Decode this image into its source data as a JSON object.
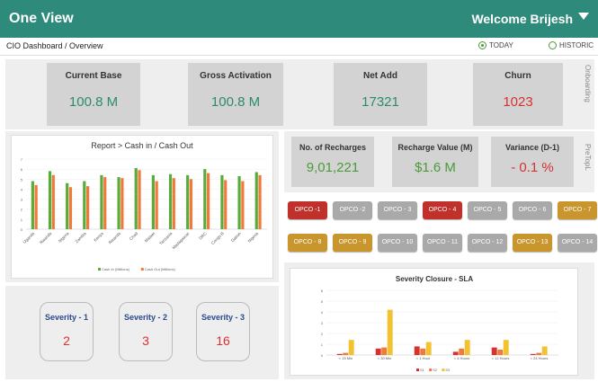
{
  "header": {
    "app_title": "One View",
    "welcome": "Welcome Brijesh"
  },
  "crumbs": {
    "path": "CIO Dashboard / Overview",
    "today": "TODAY",
    "historic": "HISTORIC",
    "selected": "TODAY"
  },
  "kpis": [
    {
      "label": "Current Base",
      "value": "100.8 M",
      "color": "#2e8a6e"
    },
    {
      "label": "Gross Activation",
      "value": "100.8 M",
      "color": "#2e8a6e"
    },
    {
      "label": "Net Add",
      "value": "17321",
      "color": "#2e8a6e"
    },
    {
      "label": "Churn",
      "value": "1023",
      "color": "#d93030"
    }
  ],
  "onboarding_label": "Onboarding",
  "recharge": {
    "side_label": "PreTopL",
    "cards": [
      {
        "label": "No. of Recharges",
        "value": "9,01,221",
        "color": "#4a9b3a"
      },
      {
        "label": "Recharge Value (M)",
        "value": "$1.6 M",
        "color": "#4a9b3a"
      },
      {
        "label": "Variance (D-1)",
        "value": "- 0.1 %",
        "color": "#d93030"
      }
    ]
  },
  "opco_buttons": [
    {
      "label": "OPCO -1",
      "status": "red"
    },
    {
      "label": "OPCO -2",
      "status": "grey"
    },
    {
      "label": "OPCO - 3",
      "status": "grey"
    },
    {
      "label": "OPCO - 4",
      "status": "red"
    },
    {
      "label": "OPCO - 5",
      "status": "grey"
    },
    {
      "label": "OPCO - 6",
      "status": "grey"
    },
    {
      "label": "OPCO - 7",
      "status": "amber"
    },
    {
      "label": "OPCO - 8",
      "status": "amber"
    },
    {
      "label": "OPCO - 9",
      "status": "amber"
    },
    {
      "label": "OPCO - 10",
      "status": "grey"
    },
    {
      "label": "OPCO - 11",
      "status": "grey"
    },
    {
      "label": "OPCO - 12",
      "status": "grey"
    },
    {
      "label": "OPCO - 13",
      "status": "amber"
    },
    {
      "label": "OPCO - 14",
      "status": "grey"
    }
  ],
  "status_colors": {
    "red": "#c0312b",
    "grey": "#a9a9a9",
    "amber": "#c9962e"
  },
  "severity": [
    {
      "label": "Severity - 1",
      "value": "2"
    },
    {
      "label": "Severity - 2",
      "value": "3"
    },
    {
      "label": "Severity - 3",
      "value": "16"
    }
  ],
  "chart_data": [
    {
      "type": "bar",
      "title": "Report >     Cash in / Cash Out",
      "categories": [
        "Uganda",
        "Rwanda",
        "Nigeria",
        "Zambia",
        "Kenya",
        "Rwanda",
        "Chad",
        "Malawi",
        "Tanzania",
        "Madagascar",
        "DRC",
        "Congo B",
        "Gabon",
        "Nigeria"
      ],
      "series": [
        {
          "name": "Cash In (Millions)",
          "color": "#5aab3c",
          "values": [
            4.8,
            5.8,
            4.6,
            4.8,
            5.4,
            5.2,
            6.1,
            5.4,
            5.5,
            5.4,
            6.0,
            5.4,
            5.3,
            5.7
          ]
        },
        {
          "name": "Cash Out (Millions)",
          "color": "#f07a3a",
          "values": [
            4.4,
            5.4,
            4.2,
            4.3,
            5.2,
            5.1,
            5.9,
            4.8,
            5.1,
            5.0,
            5.6,
            4.9,
            4.8,
            5.4
          ]
        }
      ],
      "yticks": [
        "0",
        "1",
        "2",
        "3",
        "4",
        "5",
        "6",
        "7"
      ],
      "ylim": [
        0,
        7
      ]
    },
    {
      "type": "bar",
      "title": "Severity Closure - SLA",
      "categories": [
        "< 15 Min",
        "< 30 Min",
        "< 1 Hour",
        "< 4 Hours",
        "< 12 Hours",
        "< 24 Hours"
      ],
      "series": [
        {
          "name": "S1",
          "color": "#d93030",
          "values": [
            0.1,
            0.6,
            0.8,
            0.3,
            0.7,
            0.1
          ]
        },
        {
          "name": "S2",
          "color": "#f07a3a",
          "values": [
            0.2,
            0.7,
            0.6,
            0.6,
            0.5,
            0.2
          ]
        },
        {
          "name": "S3",
          "color": "#f2c230",
          "values": [
            1.4,
            4.2,
            1.2,
            1.4,
            1.4,
            0.8
          ]
        }
      ],
      "yticks": [
        "0",
        "1",
        "2",
        "3",
        "4",
        "5",
        "6"
      ],
      "ylim": [
        0,
        6
      ]
    }
  ]
}
